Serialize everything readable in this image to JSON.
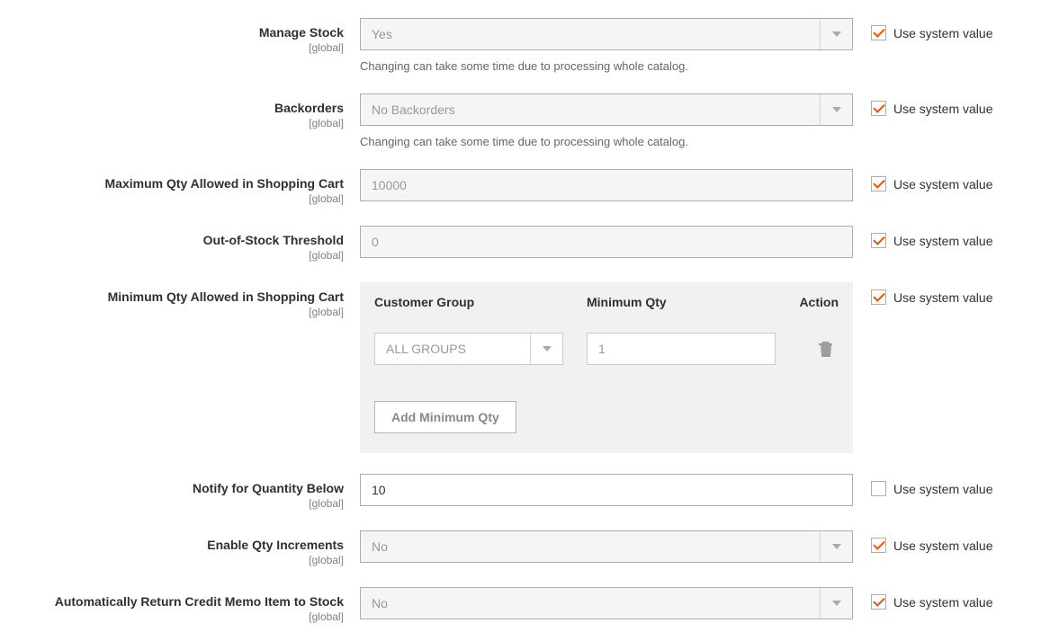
{
  "common": {
    "scope": "[global]",
    "use_system": "Use system value"
  },
  "fields": {
    "manage_stock": {
      "label": "Manage Stock",
      "value": "Yes",
      "hint": "Changing can take some time due to processing whole catalog.",
      "use_system_checked": true
    },
    "backorders": {
      "label": "Backorders",
      "value": "No Backorders",
      "hint": "Changing can take some time due to processing whole catalog.",
      "use_system_checked": true
    },
    "max_qty": {
      "label": "Maximum Qty Allowed in Shopping Cart",
      "value": "10000",
      "use_system_checked": true
    },
    "out_of_stock": {
      "label": "Out-of-Stock Threshold",
      "value": "0",
      "use_system_checked": true
    },
    "min_qty": {
      "label": "Minimum Qty Allowed in Shopping Cart",
      "headers": {
        "group": "Customer Group",
        "min": "Minimum Qty",
        "action": "Action"
      },
      "row": {
        "group": "ALL GROUPS",
        "min": "1"
      },
      "add_button": "Add Minimum Qty",
      "use_system_checked": true
    },
    "notify_below": {
      "label": "Notify for Quantity Below",
      "value": "10",
      "use_system_checked": false
    },
    "enable_incr": {
      "label": "Enable Qty Increments",
      "value": "No",
      "use_system_checked": true
    },
    "auto_return": {
      "label": "Automatically Return Credit Memo Item to Stock",
      "value": "No",
      "use_system_checked": true
    }
  }
}
